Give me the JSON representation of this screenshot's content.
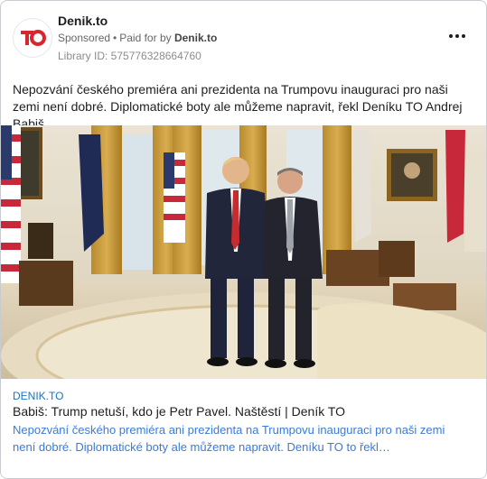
{
  "ad": {
    "page_name": "Denik.to",
    "logo_text": "TO",
    "sponsored": "Sponsored",
    "paid_for_prefix": "Paid for by",
    "paid_for_by": "Denik.to",
    "library_id": "Library ID: 575776328664760",
    "body_text": "Nepozvání českého premiéra ani prezidenta na Trumpovu inauguraci pro naši zemi není dobré. Diplomatické boty ale můžeme napravit, řekl Deníku TO Andrej Babiš.",
    "more_icon": "more-horizontal-icon"
  },
  "link": {
    "domain": "DENIK.TO",
    "title": "Babiš: Trump netuší, kdo je Petr Pavel. Naštěstí | Deník TO",
    "description": "Nepozvání českého premiéra ani prezidenta na Trumpovu inauguraci pro naši zemi není dobré. Diplomatické boty ale můžeme napravit. Deníku TO to řekl…"
  },
  "colors": {
    "brand_red": "#d7262e",
    "link_blue": "#1a73c7",
    "text_dark": "#1c1e21",
    "text_muted": "#65676b"
  }
}
